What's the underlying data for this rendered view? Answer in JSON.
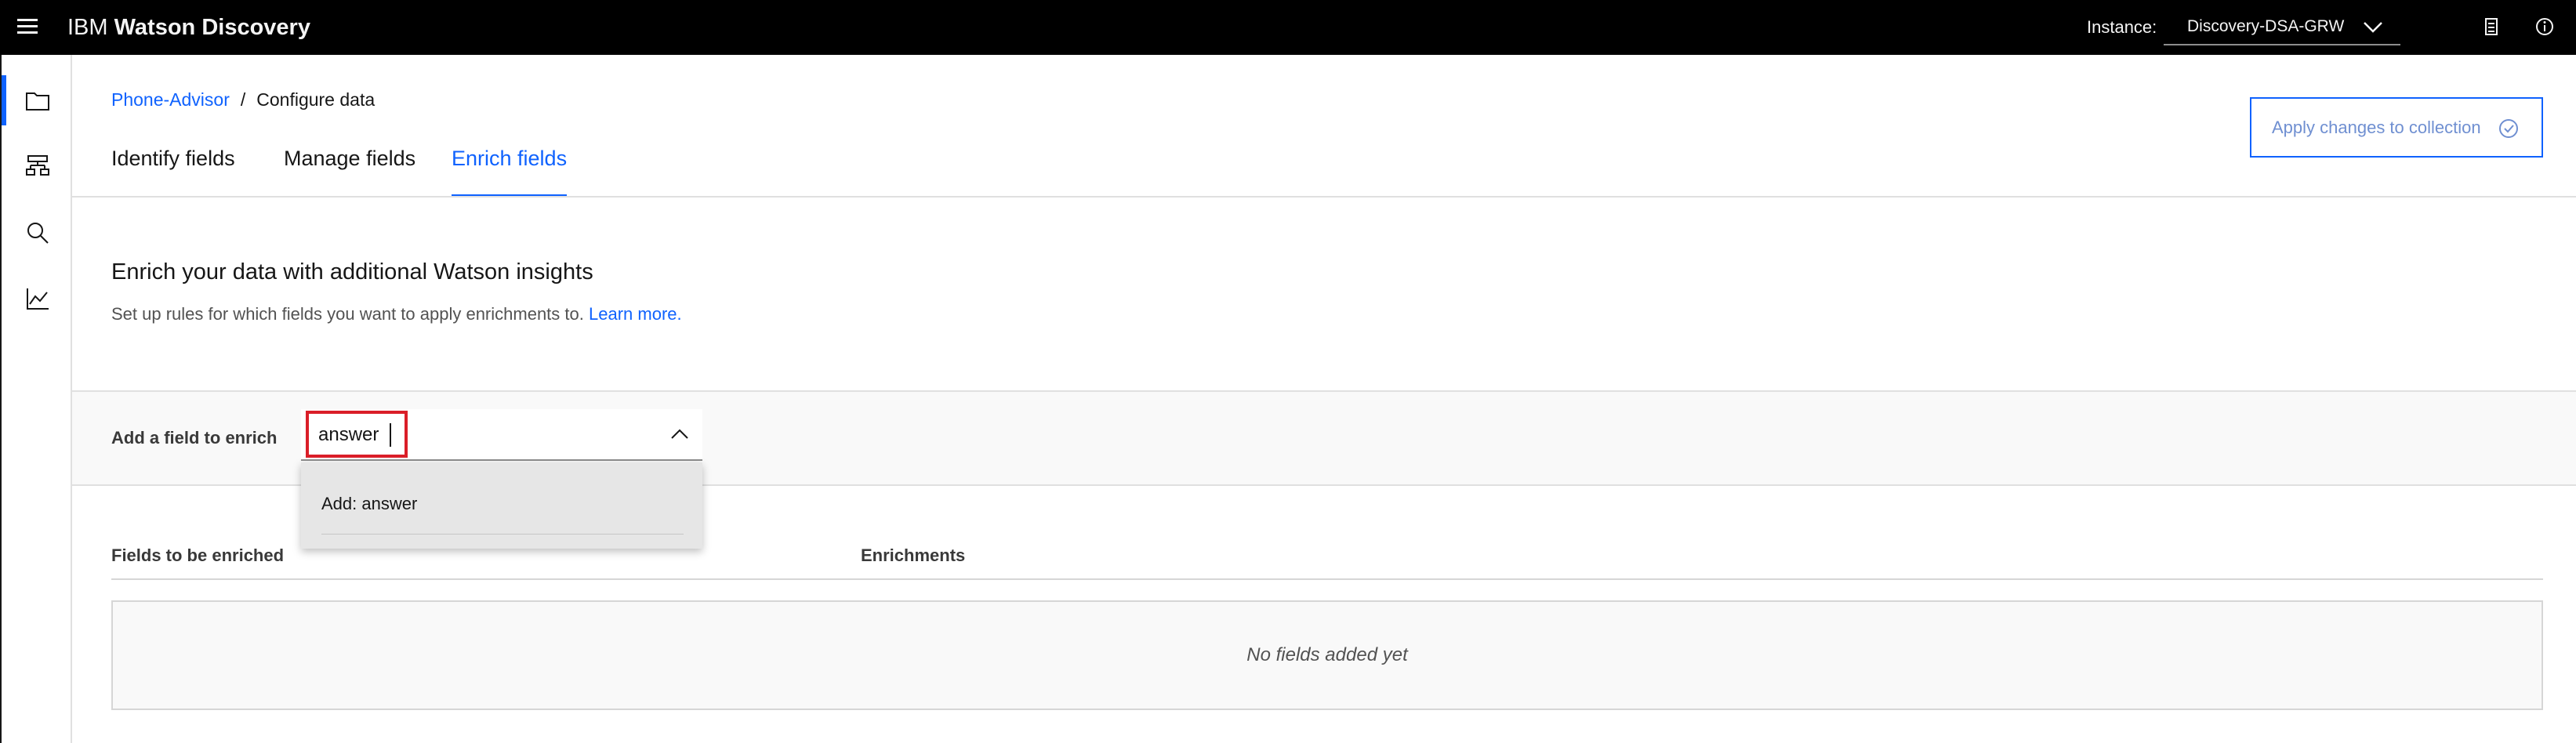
{
  "header": {
    "brand_prefix": "IBM",
    "brand_name": "Watson Discovery",
    "instance_label": "Instance:",
    "instance_value": "Discovery-DSA-GRW"
  },
  "nav": {
    "items": [
      "folder-icon",
      "model-icon",
      "search-icon",
      "analytics-icon"
    ]
  },
  "breadcrumb": {
    "project": "Phone-Advisor",
    "separator": "/",
    "current": "Configure data"
  },
  "tabs": [
    {
      "label": "Identify fields",
      "active": false
    },
    {
      "label": "Manage fields",
      "active": false
    },
    {
      "label": "Enrich fields",
      "active": true
    }
  ],
  "apply_button": "Apply changes to collection",
  "section": {
    "title": "Enrich your data with additional Watson insights",
    "description": "Set up rules for which fields you want to apply enrichments to.",
    "learn_more": "Learn more."
  },
  "add_field": {
    "label": "Add a field to enrich",
    "input_value": "answer",
    "dropdown_option": "Add: answer"
  },
  "table": {
    "columns": [
      "Fields to be enriched",
      "Enrichments"
    ],
    "empty_text": "No fields added yet"
  },
  "colors": {
    "accent": "#0f62fe",
    "highlight": "#da1e28",
    "header_bg": "#000000"
  }
}
